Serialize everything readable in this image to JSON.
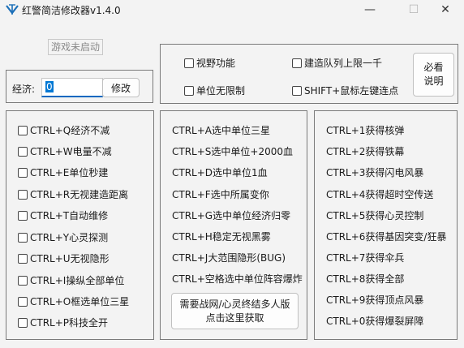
{
  "window": {
    "title": "红警简洁修改器v1.4.0",
    "min_glyph": "—",
    "max_glyph": "☐",
    "close_glyph": "✕",
    "icon": "app-logo-icon"
  },
  "status": {
    "text": "游戏未启动"
  },
  "economy": {
    "label": "经济:",
    "value": "0",
    "modify_label": "修改"
  },
  "features": {
    "items": [
      "视野功能",
      "建造队列上限一千",
      "单位无限制",
      "SHIFT+鼠标左键连点"
    ],
    "help_label_1": "必看",
    "help_label_2": "说明"
  },
  "hotkeys_col1": [
    "CTRL+Q经济不减",
    "CTRL+W电量不减",
    "CTRL+E单位秒建",
    "CTRL+R无视建造距离",
    "CTRL+T自动维修",
    "CTRL+Y心灵探测",
    "CTRL+U无视隐形",
    "CTRL+I操纵全部单位",
    "CTRL+O框选单位三星",
    "CTRL+P科技全开"
  ],
  "hotkeys_col2": [
    "CTRL+A选中单位三星",
    "CTRL+S选中单位+2000血",
    "CTRL+D选中单位1血",
    "CTRL+F选中所属变你",
    "CTRL+G选中单位经济归零",
    "CTRL+H稳定无视黑雾",
    "CTRL+J大范围隐形(BUG)",
    "CTRL+空格选中单位阵容爆炸"
  ],
  "online_button": {
    "line1": "需要战网/心灵终结多人版",
    "line2": "点击这里获取"
  },
  "hotkeys_col3": [
    "CTRL+1获得核弹",
    "CTRL+2获得铁幕",
    "CTRL+3获得闪电风暴",
    "CTRL+4获得超时空传送",
    "CTRL+5获得心灵控制",
    "CTRL+6获得基因突变/狂暴",
    "CTRL+7获得伞兵",
    "CTRL+8获得全部",
    "CTRL+9获得顶点风暴",
    "CTRL+0获得爆裂屏障"
  ]
}
